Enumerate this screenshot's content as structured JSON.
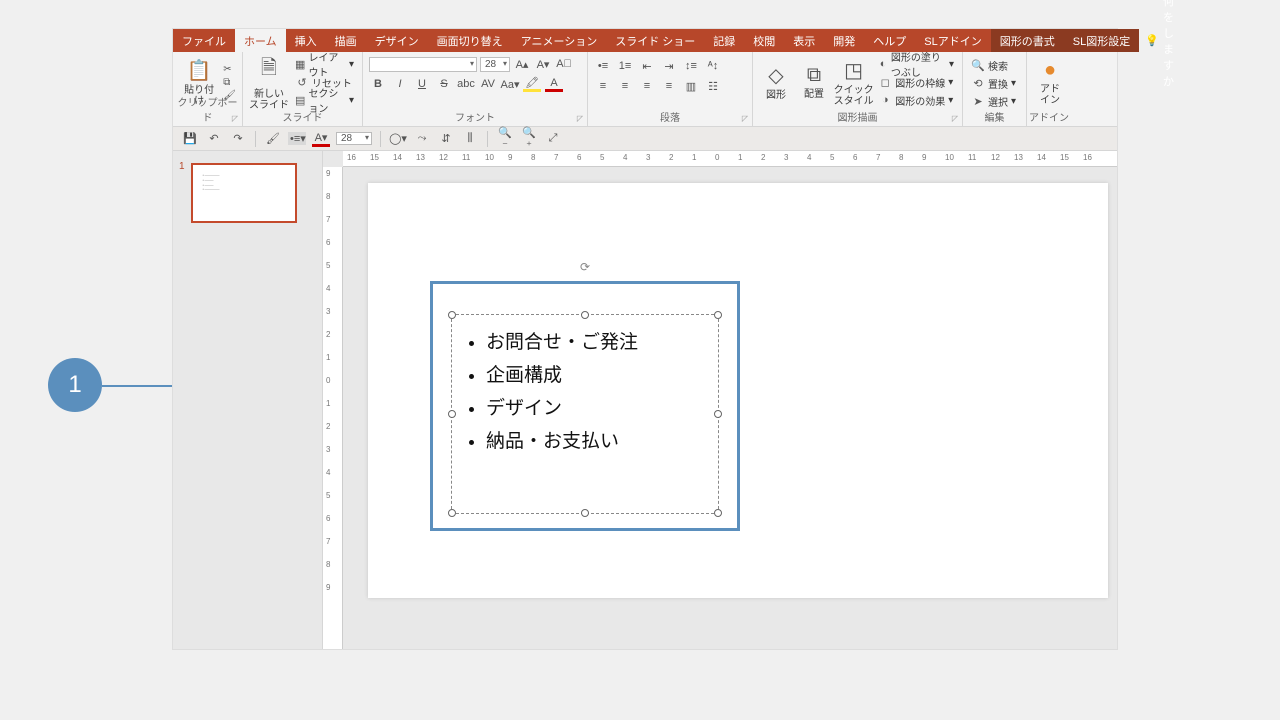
{
  "tabs": {
    "file": "ファイル",
    "home": "ホーム",
    "insert": "挿入",
    "draw": "描画",
    "design": "デザイン",
    "transitions": "画面切り替え",
    "animations": "アニメーション",
    "slideshow": "スライド ショー",
    "record": "記録",
    "review": "校閲",
    "view": "表示",
    "developer": "開発",
    "help": "ヘルプ",
    "sladdin": "SLアドイン",
    "ctx1": "図形の書式",
    "ctx2": "SL図形設定",
    "tellme": "何をしますか"
  },
  "groups": {
    "clipboard": {
      "label": "クリップボード",
      "paste": "貼り付け"
    },
    "slides": {
      "label": "スライド",
      "new": "新しい\nスライド",
      "layout": "レイアウト",
      "reset": "リセット",
      "section": "セクション"
    },
    "font": {
      "label": "フォント",
      "size": "28"
    },
    "paragraph": {
      "label": "段落"
    },
    "drawing": {
      "label": "図形描画",
      "shapes": "図形",
      "arrange": "配置",
      "quick": "クイック\nスタイル",
      "fill": "図形の塗りつぶし",
      "outline": "図形の枠線",
      "effects": "図形の効果"
    },
    "editing": {
      "label": "編集",
      "find": "検索",
      "replace": "置換",
      "select": "選択"
    },
    "addins": {
      "label": "アドイン",
      "btn": "アド\nイン"
    }
  },
  "qat": {
    "size": "28"
  },
  "thumb": {
    "num": "1"
  },
  "shape": {
    "items": [
      "お問合せ・ご発注",
      "企画構成",
      "デザイン",
      "納品・お支払い"
    ]
  },
  "annotation": {
    "num": "1"
  },
  "hruler": [
    16,
    15,
    14,
    13,
    12,
    11,
    10,
    9,
    8,
    7,
    6,
    5,
    4,
    3,
    2,
    1,
    0,
    1,
    2,
    3,
    4,
    5,
    6,
    7,
    8,
    9,
    10,
    11,
    12,
    13,
    14,
    15,
    16
  ],
  "vruler": [
    9,
    8,
    7,
    6,
    5,
    4,
    3,
    2,
    1,
    0,
    1,
    2,
    3,
    4,
    5,
    6,
    7,
    8,
    9
  ]
}
